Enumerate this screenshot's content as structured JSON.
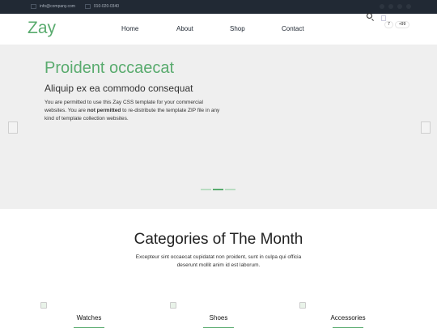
{
  "topbar": {
    "email": "info@company.com",
    "phone": "010-020-0340",
    "social_icons": [
      "facebook-icon",
      "instagram-icon",
      "twitter-icon",
      "linkedin-icon"
    ]
  },
  "nav": {
    "logo": "Zay",
    "menu": [
      "Home",
      "About",
      "Shop",
      "Contact"
    ],
    "cart_count": "7",
    "user_count": "+99"
  },
  "hero": {
    "title": "Proident occaecat",
    "subtitle": "Aliquip ex ea commodo consequat",
    "text_before": "You are permitted to use this Zay CSS template for your commercial websites. You are ",
    "text_bold": "not permitted",
    "text_after": " to re-distribute the template ZIP file in any kind of template collection websites."
  },
  "section": {
    "title": "Categories of The Month",
    "description": "Excepteur sint occaecat cupidatat non proident, sunt in culpa qui officia deserunt mollit anim id est laborum."
  },
  "categories": [
    "Watches",
    "Shoes",
    "Accessories"
  ],
  "colors": {
    "brand": "#59ab6e",
    "topbar": "#212934",
    "hero_bg": "#efefef"
  }
}
